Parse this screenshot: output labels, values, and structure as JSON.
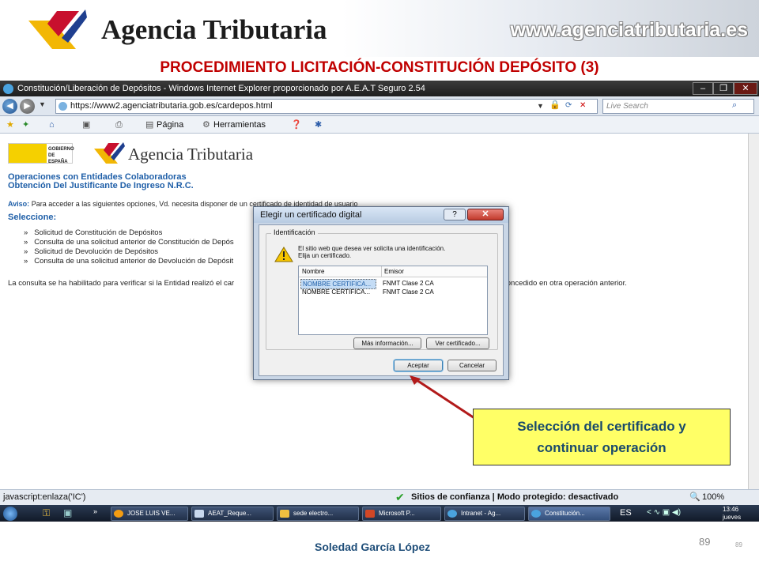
{
  "header": {
    "logo_text": "Agencia Tributaria",
    "website": "www.agenciatributaria.es"
  },
  "slide_title": "PROCEDIMIENTO LICITACIÓN-CONSTITUCIÓN DEPÓSITO (3)",
  "browser": {
    "window_title": "Constitución/Liberación de Depósitos - Windows Internet Explorer proporcionado por A.E.A.T Seguro 2.54",
    "address": "https://www2.agenciatributaria.gob.es/cardepos.html",
    "search_placeholder": "Live Search",
    "cmd_pagina": "Página",
    "cmd_herramientas": "Herramientas",
    "status_left": "javascript:enlaza('IC')",
    "status_trust": "Sitios de confianza | Modo protegido: desactivado",
    "zoom": "100%"
  },
  "webpage": {
    "gob_label": "GOBIERNO DE ESPAÑA",
    "brand": "Agencia Tributaria",
    "heading1": "Operaciones con Entidades Colaboradoras",
    "heading2": "Obtención Del Justificante De Ingreso N.R.C.",
    "aviso_label": "Aviso:",
    "aviso_text": "Para acceder a las siguientes opciones, Vd. necesita disponer de un certificado de identidad de usuario",
    "select_label": "Seleccione:",
    "options": [
      "Solicitud de Constitución de Depósitos",
      "Consulta de una solicitud anterior de Constitución de Depós",
      "Solicitud de Devolución de Depósitos",
      "Consulta de una solicitud anterior de Devolución de Depósit"
    ],
    "note_left": "La consulta se ha habilitado para verificar si la Entidad realizó el car",
    "note_right": "concedido en otra operación anterior."
  },
  "dialog": {
    "title": "Elegir un certificado digital",
    "group_label": "Identificación",
    "message_line1": "El sitio web que desea ver solicita una identificación.",
    "message_line2": "Elija un certificado.",
    "col_name": "Nombre",
    "col_issuer": "Emisor",
    "rows": [
      {
        "name": "NOMBRE CERTIFICA...",
        "issuer": "FNMT Clase 2 CA"
      },
      {
        "name": "NOMBRE CERTIFICA...",
        "issuer": "FNMT Clase 2 CA"
      }
    ],
    "btn_more": "Más información...",
    "btn_view": "Ver certificado...",
    "btn_ok": "Aceptar",
    "btn_cancel": "Cancelar"
  },
  "callout": {
    "line1": "Selección del certificado y",
    "line2": "continuar operación"
  },
  "taskbar": {
    "items": [
      "JOSE LUIS VE...",
      "AEAT_Reque...",
      "sede electro...",
      "Microsoft P...",
      "Intranet - Ag...",
      "Constitución..."
    ],
    "lang": "ES",
    "time": "13:46",
    "day": "jueves"
  },
  "footer": {
    "author": "Soledad García López",
    "page": "89",
    "page_small": "89"
  }
}
